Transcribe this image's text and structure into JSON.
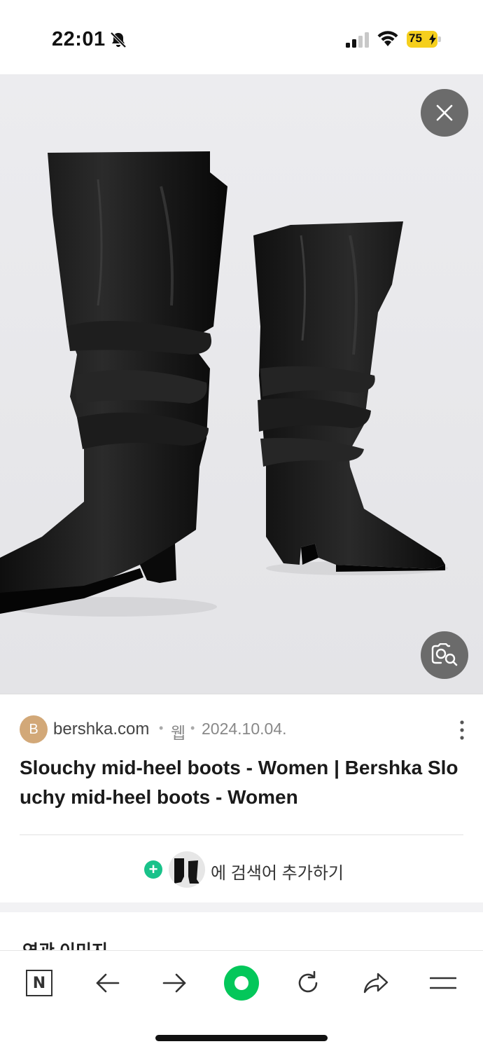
{
  "status_bar": {
    "time": "22:01",
    "battery_level": "75",
    "icons": [
      "bell-slash-icon",
      "cellular-signal-icon",
      "wifi-icon",
      "battery-charging-icon"
    ]
  },
  "image_viewer": {
    "close_icon": "close-icon",
    "lens_icon": "image-search-icon"
  },
  "result": {
    "source_initial": "B",
    "domain": "bershka.com",
    "separator": "•",
    "type": "웹",
    "date": "2024.10.04.",
    "title": "Slouchy mid-heel boots - Women | Bershka Slouchy mid-heel boots - Women",
    "more_icon": "more-vertical-icon",
    "add_plus": "+",
    "add_search_text": "에 검색어 추가하기"
  },
  "related": {
    "title": "연관 이미지"
  },
  "toolbar": {
    "home_label": "N",
    "items": [
      "naver-home-icon",
      "back-arrow-icon",
      "forward-arrow-icon",
      "green-dot-button",
      "refresh-icon",
      "share-icon",
      "menu-icon"
    ]
  },
  "colors": {
    "accent_green": "#03c75a",
    "battery_yellow": "#f5cf1d",
    "plus_green": "#19c28a",
    "avatar_tan": "#d2a878"
  }
}
